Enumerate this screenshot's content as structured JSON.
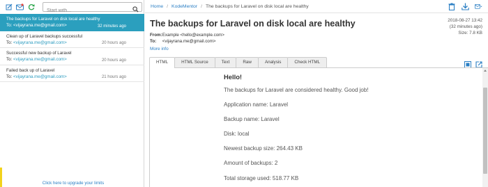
{
  "sidebar": {
    "search_placeholder": "Start with...",
    "messages": [
      {
        "subject": "The backups for Laravel on disk local are healthy",
        "to_label": "To:",
        "to": "<vijayrana.me@gmail.com>",
        "time": "32 minutes ago",
        "selected": true
      },
      {
        "subject": "Clean up of Laravel backups successful",
        "to_label": "To:",
        "to": "<vijayrana.me@gmail.com>",
        "time": "20 hours ago",
        "selected": false
      },
      {
        "subject": "Successful new backup of Laravel",
        "to_label": "To:",
        "to": "<vijayrana.me@gmail.com>",
        "time": "20 hours ago",
        "selected": false
      },
      {
        "subject": "Failed back up of Laravel",
        "to_label": "To:",
        "to": "<vijayrana.me@gmail.com>",
        "time": "21 hours ago",
        "selected": false
      }
    ],
    "upgrade_text": "Click here to upgrade your limits"
  },
  "breadcrumb": {
    "home": "Home",
    "inbox": "KodeMentor",
    "current": "The backups for Laravel on disk local are healthy"
  },
  "message": {
    "subject": "The backups for Laravel on disk local are healthy",
    "date": "2018-08-27 13:42",
    "relative": "(32 minutes ago)",
    "size": "Size: 7.8 KB",
    "from_label": "From:",
    "from": "Example <hello@example.com>",
    "to_label": "To:",
    "to": "<vijayrana.me@gmail.com>",
    "more_info": "More info"
  },
  "tabs": [
    "HTML",
    "HTML Source",
    "Text",
    "Raw",
    "Analysis",
    "Check HTML"
  ],
  "body": {
    "greeting": "Hello!",
    "lines": [
      "The backups for Laravel are considered healthy. Good job!",
      "Application name: Laravel",
      "Backup name: Laravel",
      "Disk: local",
      "Newest backup size: 264.43 KB",
      "Amount of backups: 2",
      "Total storage used: 518.77 KB"
    ]
  },
  "colors": {
    "accent": "#2b9fbe",
    "link": "#2b7fc4",
    "upgrade_marker": "#f2d21c"
  },
  "icons": [
    "compose-icon",
    "inbox-icon",
    "refresh-icon",
    "search-icon",
    "trash-icon",
    "download-icon",
    "forward-icon",
    "open-external-icon",
    "new-window-icon"
  ]
}
